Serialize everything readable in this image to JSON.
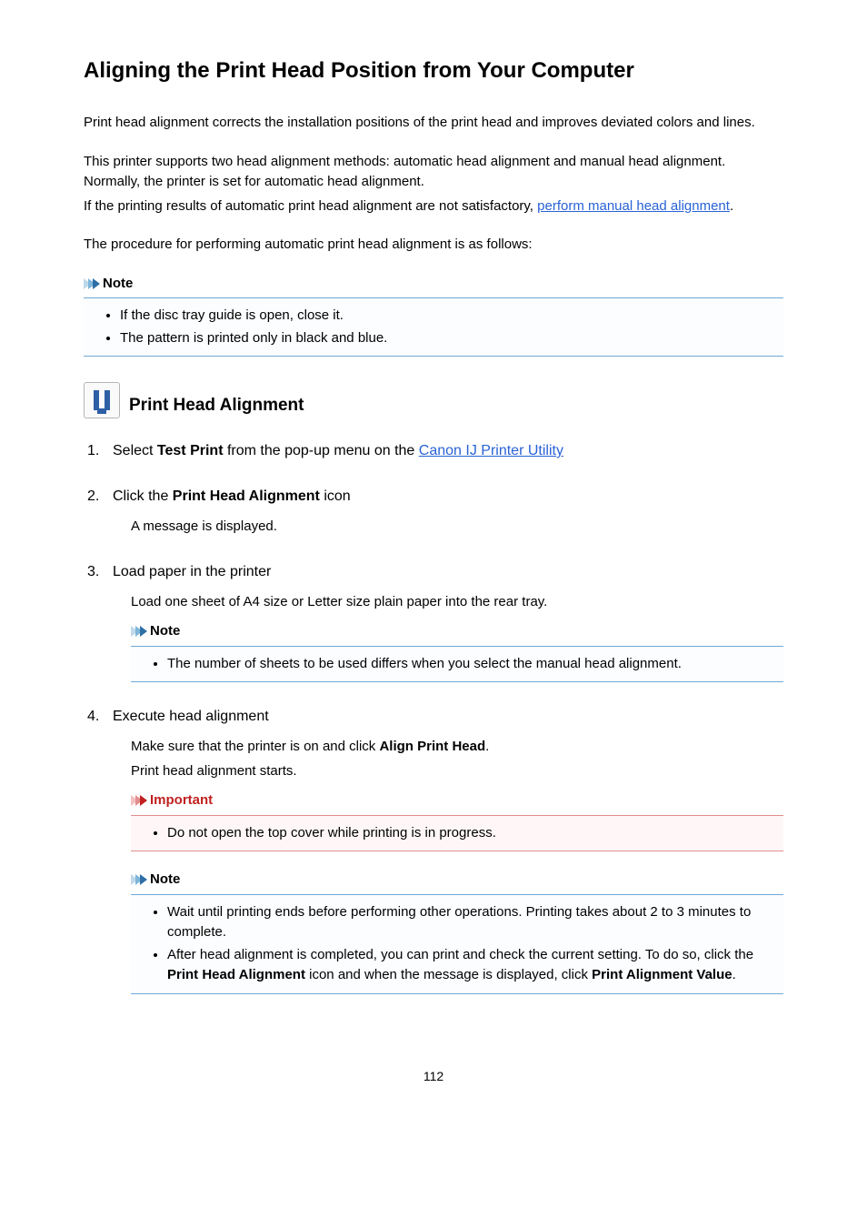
{
  "title": "Aligning the Print Head Position from Your Computer",
  "intro": [
    "Print head alignment corrects the installation positions of the print head and improves deviated colors and lines.",
    "This printer supports two head alignment methods: automatic head alignment and manual head alignment. Normally, the printer is set for automatic head alignment.",
    "If the printing results of automatic print head alignment are not satisfactory, ",
    "perform manual head alignment",
    ".",
    "The procedure for performing automatic print head alignment is as follows:"
  ],
  "note_label": "Note",
  "important_label": "Important",
  "top_note_items": [
    "If the disc tray guide is open, close it.",
    "The pattern is printed only in black and blue."
  ],
  "section_title": "Print Head Alignment",
  "steps": {
    "s1": {
      "prefix": "Select ",
      "bold": "Test Print",
      "middle": " from the pop-up menu on the ",
      "link": "Canon IJ Printer Utility"
    },
    "s2": {
      "prefix": "Click the ",
      "bold": "Print Head Alignment",
      "suffix": " icon",
      "body": "A message is displayed."
    },
    "s3": {
      "head": "Load paper in the printer",
      "body": "Load one sheet of A4 size or Letter size plain paper into the rear tray.",
      "note_item": "The number of sheets to be used differs when you select the manual head alignment."
    },
    "s4": {
      "head": "Execute head alignment",
      "body1_pre": "Make sure that the printer is on and click ",
      "body1_bold": "Align Print Head",
      "body1_post": ".",
      "body2": "Print head alignment starts.",
      "important_item": "Do not open the top cover while printing is in progress.",
      "note_items": {
        "a": "Wait until printing ends before performing other operations. Printing takes about 2 to 3 minutes to complete.",
        "b_pre": "After head alignment is completed, you can print and check the current setting. To do so, click the ",
        "b_bold1": "Print Head Alignment",
        "b_mid": " icon and when the message is displayed, click ",
        "b_bold2": "Print Alignment Value",
        "b_post": "."
      }
    }
  },
  "page_number": "112"
}
